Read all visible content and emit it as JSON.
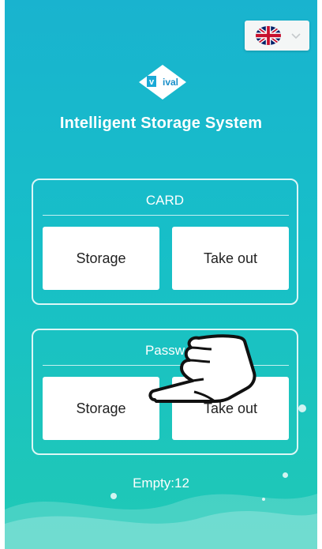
{
  "header": {
    "title": "Intelligent Storage System",
    "logo_text": "vival"
  },
  "language": {
    "selected": "English (UK)",
    "flag_icon": "uk-flag-icon"
  },
  "panels": [
    {
      "title": "CARD",
      "storage_label": "Storage",
      "takeout_label": "Take out"
    },
    {
      "title": "Passw",
      "storage_label": "Storage",
      "takeout_label": "Take out"
    }
  ],
  "status": {
    "empty_text": "Empty:12"
  },
  "colors": {
    "background_top": "#19b3cf",
    "background_bottom": "#20c9b5",
    "button_bg": "#ffffff",
    "text_dark": "#222222"
  }
}
